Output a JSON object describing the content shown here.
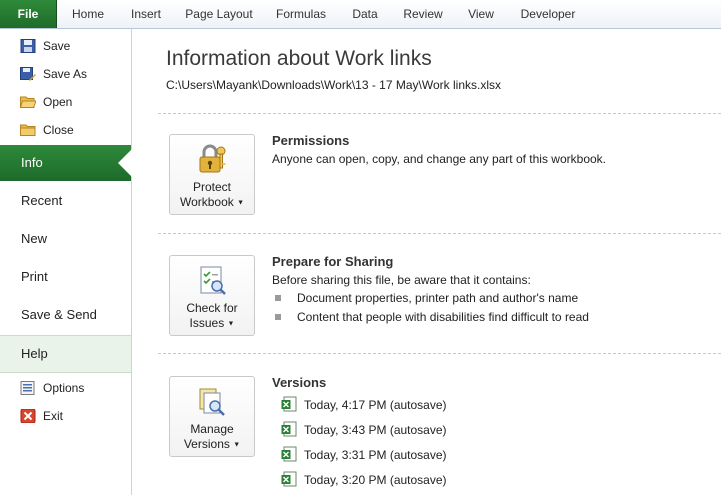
{
  "ribbon": {
    "tabs": [
      {
        "label": "File"
      },
      {
        "label": "Home"
      },
      {
        "label": "Insert"
      },
      {
        "label": "Page Layout"
      },
      {
        "label": "Formulas"
      },
      {
        "label": "Data"
      },
      {
        "label": "Review"
      },
      {
        "label": "View"
      },
      {
        "label": "Developer"
      }
    ]
  },
  "nav": {
    "commands_top": [
      {
        "label": "Save",
        "icon": "save-icon"
      },
      {
        "label": "Save As",
        "icon": "save-as-icon"
      },
      {
        "label": "Open",
        "icon": "open-folder-icon"
      },
      {
        "label": "Close",
        "icon": "close-folder-icon"
      }
    ],
    "tabs": [
      {
        "label": "Info"
      },
      {
        "label": "Recent"
      },
      {
        "label": "New"
      },
      {
        "label": "Print"
      },
      {
        "label": "Save & Send"
      },
      {
        "label": "Help"
      }
    ],
    "commands_bottom": [
      {
        "label": "Options",
        "icon": "options-icon"
      },
      {
        "label": "Exit",
        "icon": "exit-icon"
      }
    ]
  },
  "main": {
    "title": "Information about Work links",
    "path": "C:\\Users\\Mayank\\Downloads\\Work\\13 - 17 May\\Work links.xlsx",
    "permissions": {
      "button_line1": "Protect",
      "button_line2": "Workbook",
      "title": "Permissions",
      "text": "Anyone can open, copy, and change any part of this workbook."
    },
    "prepare": {
      "button_line1": "Check for",
      "button_line2": "Issues",
      "title": "Prepare for Sharing",
      "text": "Before sharing this file, be aware that it contains:",
      "bullets": [
        "Document properties, printer path and author's name",
        "Content that people with disabilities find difficult to read"
      ]
    },
    "versions": {
      "button_line1": "Manage",
      "button_line2": "Versions",
      "title": "Versions",
      "items": [
        "Today, 4:17 PM (autosave)",
        "Today, 3:43 PM (autosave)",
        "Today, 3:31 PM (autosave)",
        "Today, 3:20 PM (autosave)"
      ]
    }
  },
  "colors": {
    "accent": "#217346",
    "file_tab": "#2a7f36",
    "help_bg": "#eaf3ea"
  }
}
